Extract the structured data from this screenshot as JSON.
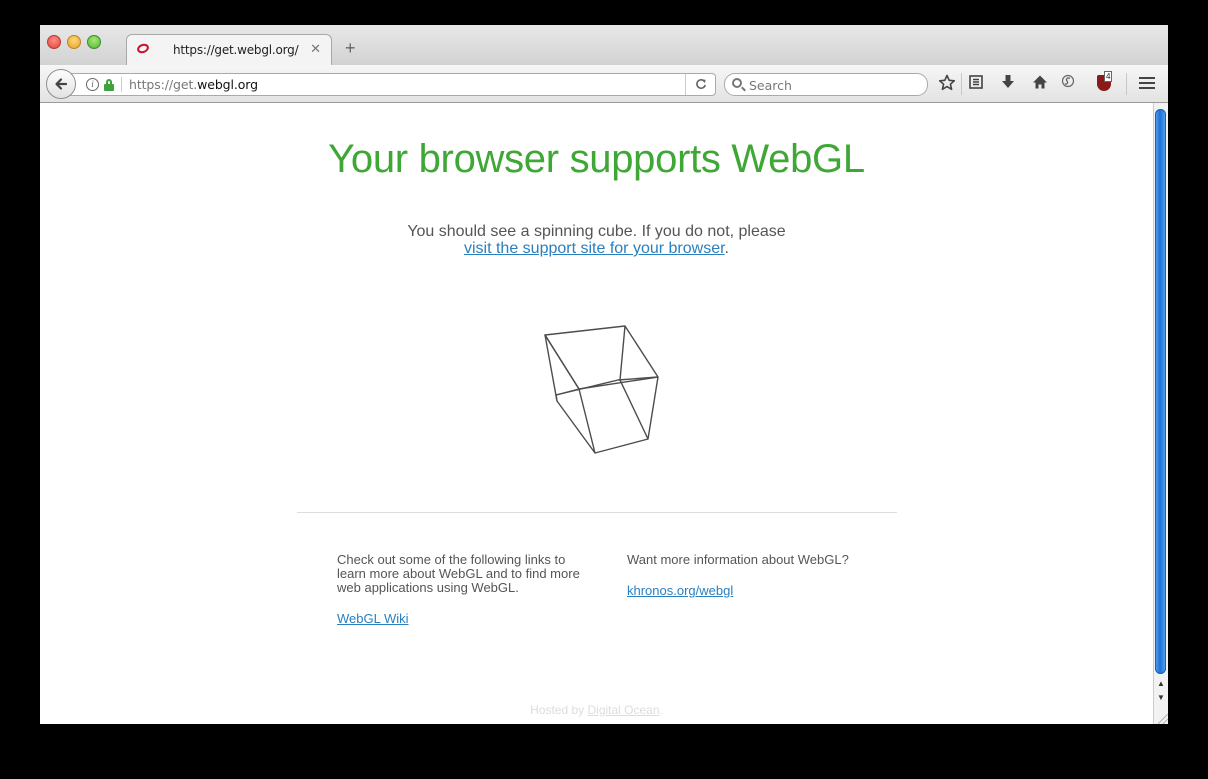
{
  "tab": {
    "title": "https://get.webgl.org/",
    "close_label": "✕",
    "new_tab_label": "+"
  },
  "navbar": {
    "url_scheme": "https://",
    "url_prefix": "get.",
    "url_host": "webgl.org",
    "search_placeholder": "Search"
  },
  "icons": {
    "back": "back-arrow-icon",
    "info": "info-icon",
    "lock": "lock-icon",
    "reload": "reload-icon",
    "search": "search-icon",
    "bookmark": "bookmark-star-icon",
    "reading_list": "reading-list-icon",
    "downloads": "download-icon",
    "home": "home-icon",
    "sync": "sync-icon",
    "ublock": "ublock-icon",
    "menu": "hamburger-menu-icon"
  },
  "page": {
    "headline": "Your browser supports WebGL",
    "intro_text": "You should see a spinning cube. If you do not, please",
    "intro_link": "visit the support site for your browser",
    "intro_end": ".",
    "left_col_text": "Check out some of the following links to learn more about WebGL and to find more web applications using WebGL.",
    "left_col_link": "WebGL Wiki",
    "right_col_text": "Want more information about WebGL?",
    "right_col_link": "khronos.org/webgl",
    "footer_text": "Hosted by ",
    "footer_link": "Digital Ocean",
    "footer_end": "."
  },
  "colors": {
    "headline": "#3fa736",
    "link": "#2a7fbf",
    "body_text": "#555555",
    "scroll_thumb": "#1b71d8"
  }
}
